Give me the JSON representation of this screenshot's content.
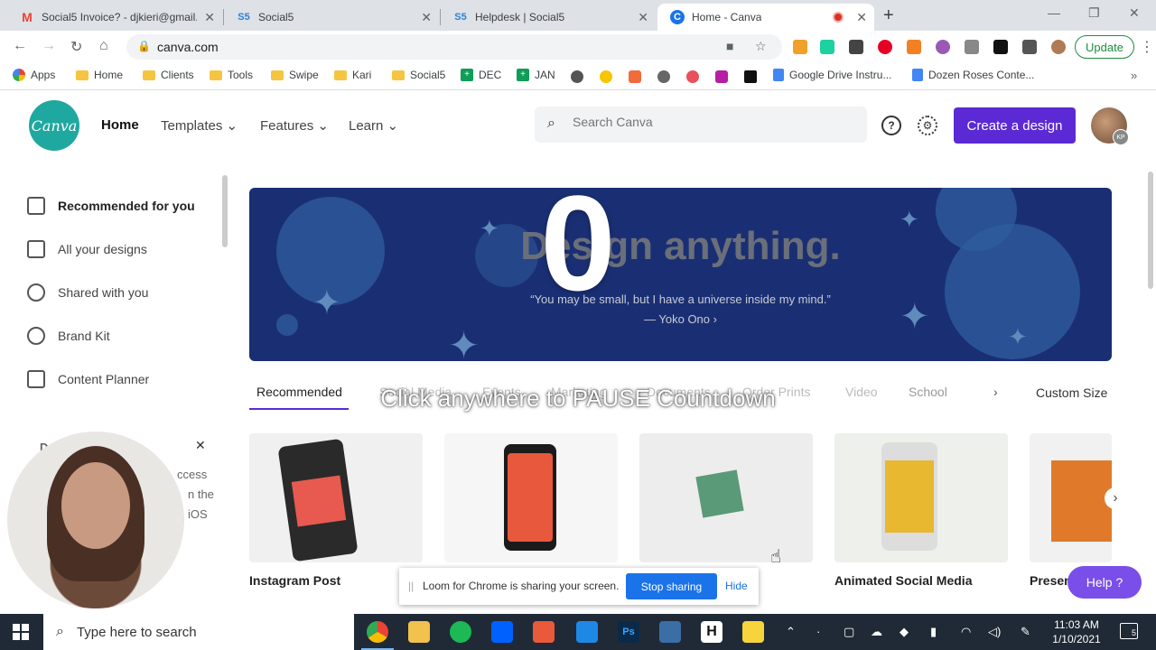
{
  "browser": {
    "tabs": [
      {
        "favicon": "gmail-icon",
        "title": "Social5 Invoice? - djkieri@gmail.c",
        "active": false
      },
      {
        "favicon": "S5",
        "title": "Social5",
        "active": false
      },
      {
        "favicon": "S5",
        "title": "Helpdesk | Social5",
        "active": false
      },
      {
        "favicon": "C",
        "title": "Home - Canva",
        "active": true
      }
    ],
    "url": "canva.com",
    "update_label": "Update",
    "bookmarks": [
      "Apps",
      "Home",
      "Clients",
      "Tools",
      "Swipe",
      "Kari",
      "Social5",
      "DEC",
      "JAN",
      "Google Drive Instru...",
      "Dozen Roses Conte..."
    ]
  },
  "canva": {
    "logo_text": "Canva",
    "nav": {
      "home": "Home",
      "templates": "Templates",
      "features": "Features",
      "learn": "Learn"
    },
    "search_placeholder": "Search Canva",
    "create_label": "Create a design",
    "avatar_initials": "KP",
    "sidebar": [
      {
        "label": "Recommended for you",
        "icon": "home-icon"
      },
      {
        "label": "All your designs",
        "icon": "grid-icon"
      },
      {
        "label": "Shared with you",
        "icon": "people-icon"
      },
      {
        "label": "Brand Kit",
        "icon": "brand-kit-icon"
      },
      {
        "label": "Content Planner",
        "icon": "calendar-icon"
      }
    ],
    "hero": {
      "title": "Design anything.",
      "quote": "“You may be small, but I have a universe inside my mind.”",
      "author": "— Yoko Ono ›"
    },
    "categories": [
      "Recommended",
      "Social Media",
      "Events",
      "Marketing",
      "Documents",
      "Order Prints",
      "Video",
      "School"
    ],
    "custom_size": "Custom Size",
    "cards": [
      "Instagram Post",
      "",
      "",
      "Animated Social Media",
      "Presen"
    ],
    "help_label": "Help ?"
  },
  "overlay": {
    "countdown": "0",
    "pause_message": "Click anywhere to PAUSE Countdown",
    "behind_panel": [
      "D",
      "ccess",
      "n the",
      "iOS"
    ]
  },
  "loom": {
    "message": "Loom for Chrome is sharing your screen.",
    "stop_label": "Stop sharing",
    "hide_label": "Hide"
  },
  "taskbar": {
    "search_placeholder": "Type here to search",
    "time": "11:03 AM",
    "date": "1/10/2021",
    "notification_count": "5"
  },
  "colors": {
    "canva_purple": "#5b2ad4",
    "canva_teal": "#1fa8a0",
    "hero_navy": "#1a2f73",
    "loom_blue": "#1a73e8"
  }
}
